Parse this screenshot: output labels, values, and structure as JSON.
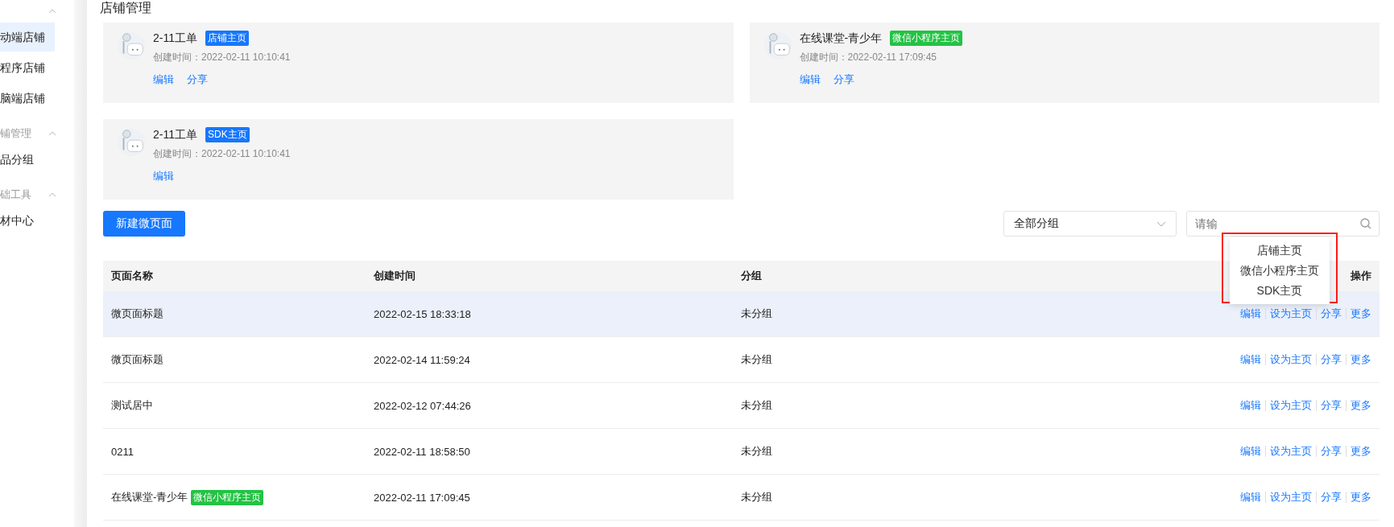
{
  "header": {
    "title": "店铺管理"
  },
  "sidebar": {
    "groups": [
      {
        "expanded": true,
        "items": [
          {
            "label": "动端店铺",
            "selected": true
          },
          {
            "label": "程序店铺",
            "selected": false
          },
          {
            "label": "脑端店铺",
            "selected": false
          }
        ]
      },
      {
        "title": "铺管理",
        "expanded": true,
        "items": [
          {
            "label": "品分组",
            "selected": false
          }
        ]
      },
      {
        "title": "础工具",
        "expanded": true,
        "items": [
          {
            "label": "材中心",
            "selected": false
          }
        ]
      }
    ]
  },
  "home_cards": [
    {
      "name": "2-11工单",
      "tag": {
        "label": "店铺主页",
        "color": "#1677ff"
      },
      "created": "创建时间：2022-02-11 10:10:41",
      "actions": [
        "编辑",
        "分享"
      ]
    },
    {
      "name": "在线课堂-青少年",
      "tag": {
        "label": "微信小程序主页",
        "color": "#23c343"
      },
      "created": "创建时间：2022-02-11 17:09:45",
      "actions": [
        "编辑",
        "分享"
      ]
    },
    {
      "name": "2-11工单",
      "tag": {
        "label": "SDK主页",
        "color": "#1677ff"
      },
      "created": "创建时间：2022-02-11 10:10:41",
      "actions": [
        "编辑"
      ]
    }
  ],
  "toolbar": {
    "new_button": "新建微页面",
    "group_select": {
      "value": "全部分组"
    },
    "search": {
      "placeholder": "请输"
    }
  },
  "table": {
    "columns": [
      "页面名称",
      "创建时间",
      "分组",
      "操作"
    ],
    "rows": [
      {
        "name": "微页面标题",
        "created": "2022-02-15 18:33:18",
        "group": "未分组",
        "actions": [
          "编辑",
          "设为主页",
          "分享",
          "更多"
        ],
        "selected": true
      },
      {
        "name": "微页面标题",
        "created": "2022-02-14 11:59:24",
        "group": "未分组",
        "actions": [
          "编辑",
          "设为主页",
          "分享",
          "更多"
        ],
        "selected": false
      },
      {
        "name": "测试居中",
        "created": "2022-02-12 07:44:26",
        "group": "未分组",
        "actions": [
          "编辑",
          "设为主页",
          "分享",
          "更多"
        ],
        "selected": false
      },
      {
        "name": "0211",
        "created": "2022-02-11 18:58:50",
        "group": "未分组",
        "actions": [
          "编辑",
          "设为主页",
          "分享",
          "更多"
        ],
        "selected": false
      },
      {
        "name": "在线课堂-青少年",
        "tag": {
          "label": "微信小程序主页",
          "color": "#23c343"
        },
        "created": "2022-02-11 17:09:45",
        "group": "未分组",
        "actions": [
          "编辑",
          "设为主页",
          "分享",
          "更多"
        ],
        "selected": false
      }
    ]
  },
  "set_home_menu": {
    "items": [
      "店铺主页",
      "微信小程序主页",
      "SDK主页"
    ]
  }
}
